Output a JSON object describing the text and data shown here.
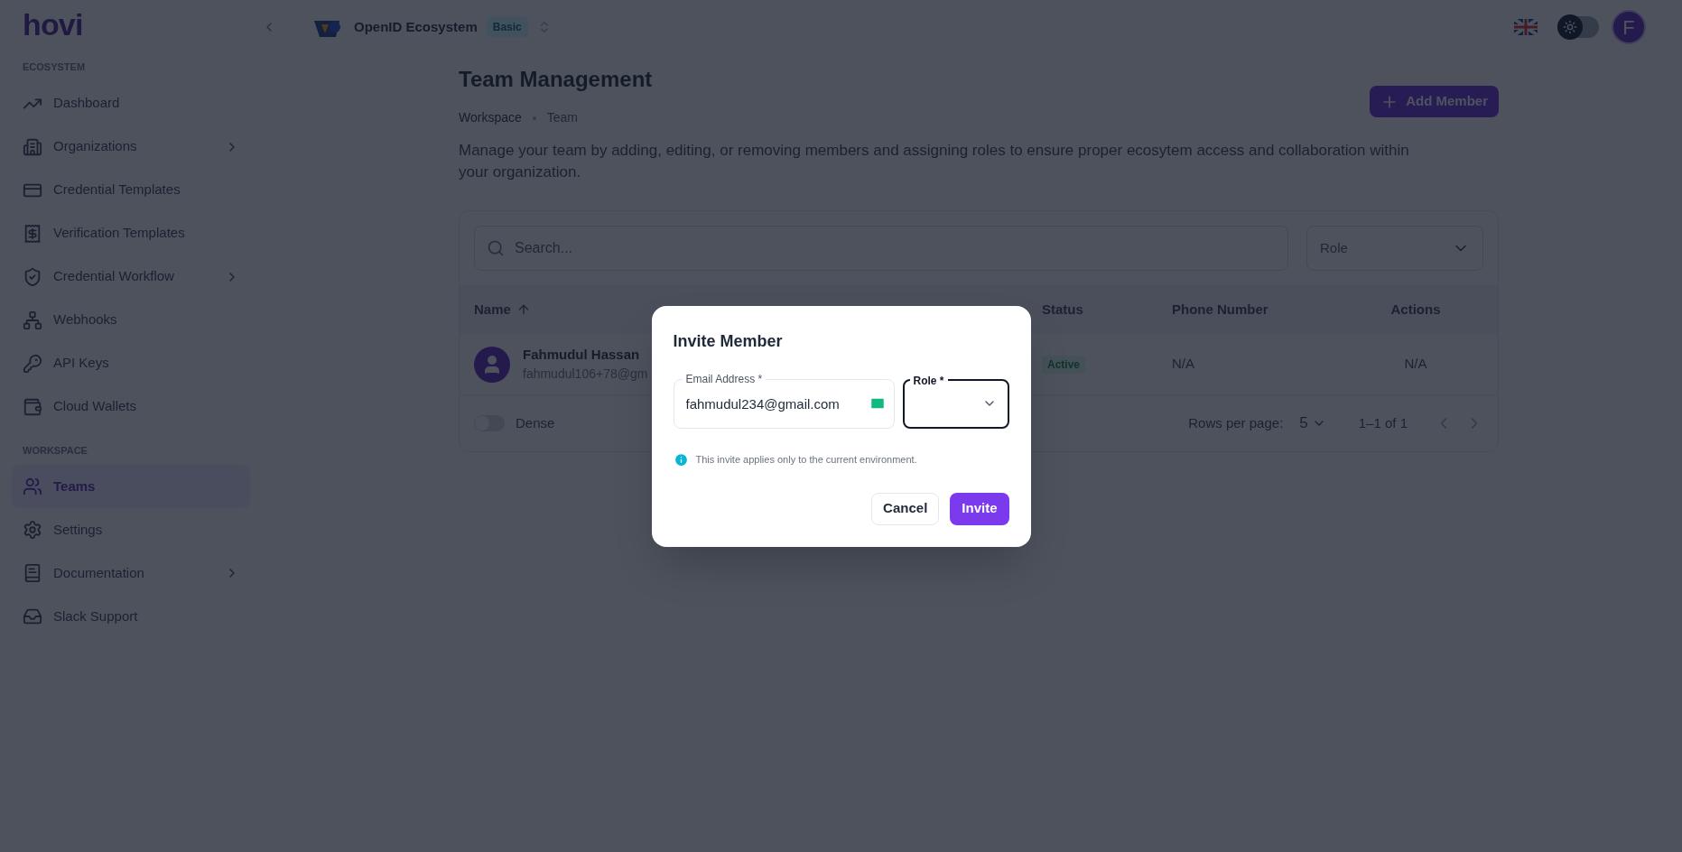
{
  "logo": "hovi",
  "sidebar": {
    "sections": [
      {
        "heading": "ECOSYSTEM",
        "items": [
          {
            "label": "Dashboard",
            "expandable": false,
            "selected": false
          },
          {
            "label": "Organizations",
            "expandable": true,
            "selected": false
          },
          {
            "label": "Credential Templates",
            "expandable": false,
            "selected": false
          },
          {
            "label": "Verification Templates",
            "expandable": false,
            "selected": false
          },
          {
            "label": "Credential Workflow",
            "expandable": true,
            "selected": false
          },
          {
            "label": "Webhooks",
            "expandable": false,
            "selected": false
          },
          {
            "label": "API Keys",
            "expandable": false,
            "selected": false
          },
          {
            "label": "Cloud Wallets",
            "expandable": false,
            "selected": false
          }
        ]
      },
      {
        "heading": "WORKSPACE",
        "items": [
          {
            "label": "Teams",
            "expandable": false,
            "selected": true
          },
          {
            "label": "Settings",
            "expandable": false,
            "selected": false
          },
          {
            "label": "Documentation",
            "expandable": true,
            "selected": false
          },
          {
            "label": "Slack Support",
            "expandable": false,
            "selected": false
          }
        ]
      }
    ]
  },
  "header": {
    "ecosystem": "OpenID Ecosystem",
    "plan_badge": "Basic",
    "dark_mode": false,
    "avatar_initial": "F"
  },
  "page": {
    "title": "Team Management",
    "breadcrumbs": [
      "Workspace",
      "Team"
    ],
    "description": "Manage your team by adding, editing, or removing members and assigning roles to ensure proper ecosytem access and collaboration within your organization.",
    "add_button": "Add Member"
  },
  "filters": {
    "search_placeholder": "Search...",
    "role_placeholder": "Role"
  },
  "table": {
    "columns": [
      {
        "label": "Name",
        "sorted": true
      },
      {
        "label": "Status",
        "sorted": false
      },
      {
        "label": "Phone Number",
        "sorted": false
      },
      {
        "label": "Actions",
        "sorted": false
      }
    ],
    "rows": [
      {
        "name": "Fahmudul Hassan",
        "email": "fahmudul106+78@gm",
        "status": "Active",
        "phone": "N/A",
        "actions": "N/A"
      }
    ]
  },
  "footer": {
    "dense_label": "Dense",
    "dense_on": false,
    "rows_per_page_label": "Rows per page:",
    "rows_per_page": "5",
    "range": "1–1 of 1"
  },
  "dialog": {
    "title": "Invite Member",
    "email_label": "Email Address *",
    "email_value": "fahmudul234@gmail.com",
    "role_label": "Role *",
    "role_focused": true,
    "info": "This invite applies only to the current environment.",
    "cancel": "Cancel",
    "confirm": "Invite"
  }
}
